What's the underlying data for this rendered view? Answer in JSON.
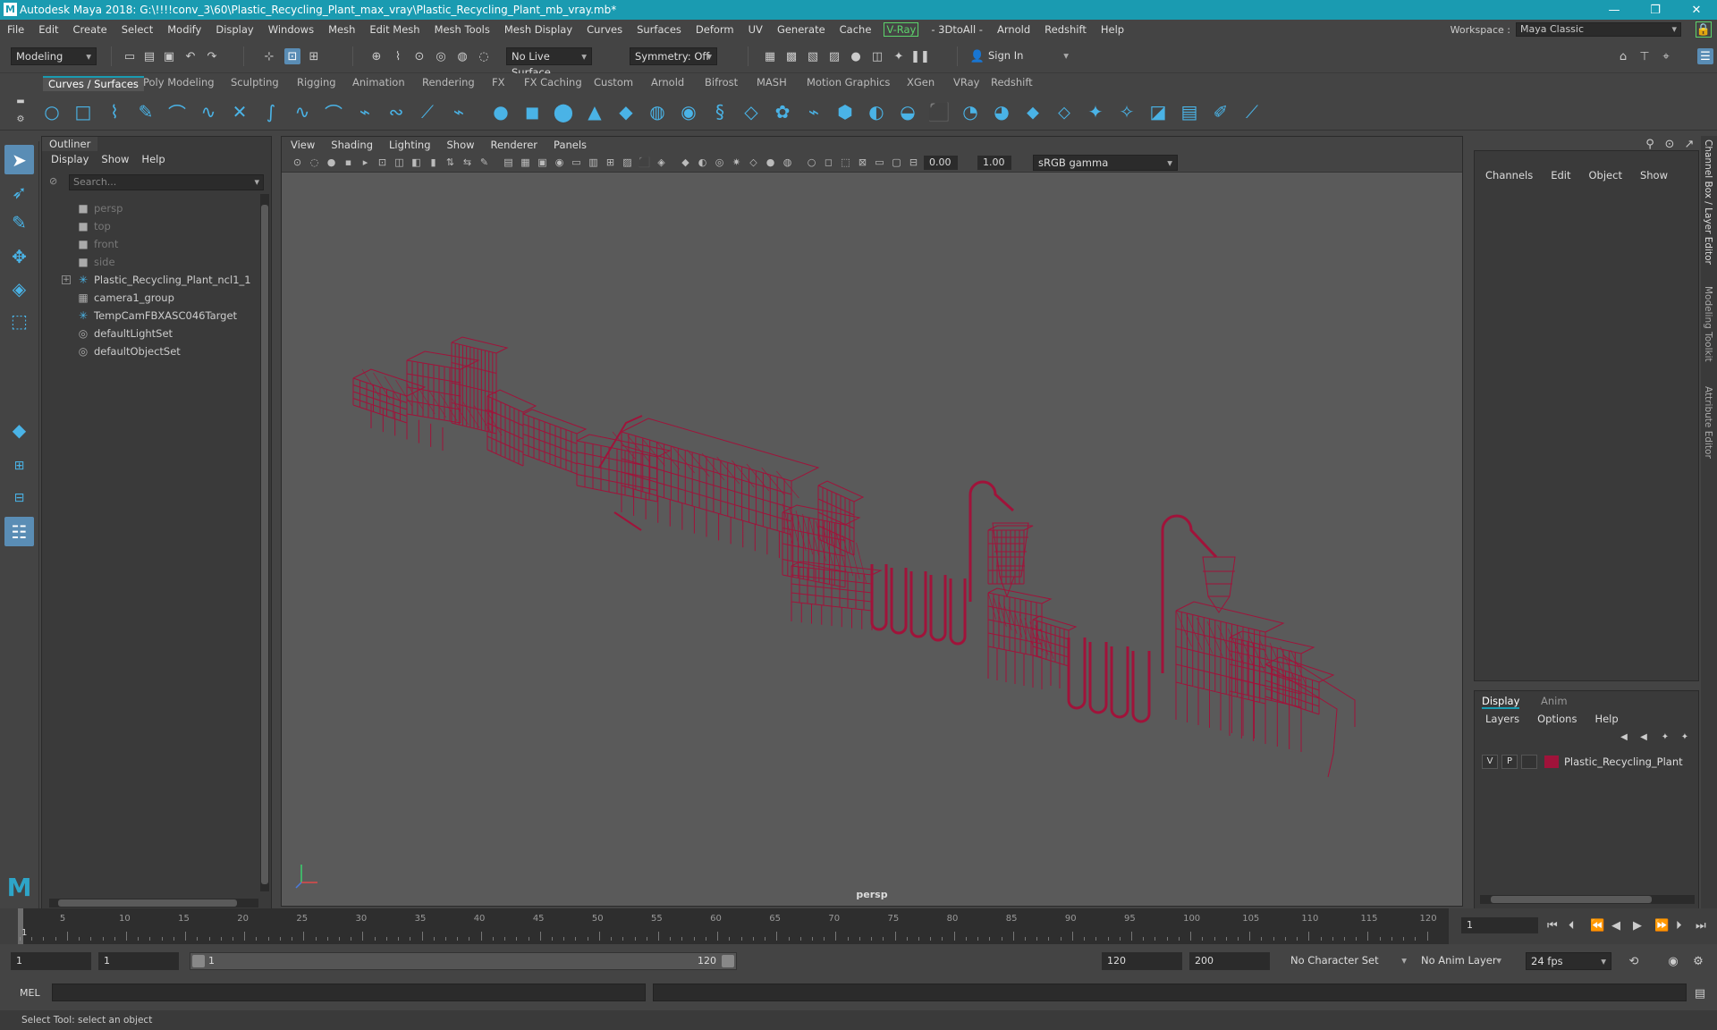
{
  "window": {
    "title": "Autodesk Maya 2018: G:\\!!!!conv_3\\60\\Plastic_Recycling_Plant_max_vray\\Plastic_Recycling_Plant_mb_vray.mb*",
    "logo": "M",
    "min": "—",
    "max": "❐",
    "close": "✕"
  },
  "menu": [
    "File",
    "Edit",
    "Create",
    "Select",
    "Modify",
    "Display",
    "Windows",
    "Mesh",
    "Edit Mesh",
    "Mesh Tools",
    "Mesh Display",
    "Curves",
    "Surfaces",
    "Deform",
    "UV",
    "Generate",
    "Cache"
  ],
  "menu_vray": "V-Ray",
  "menu2": [
    "- 3DtoAll -",
    "Arnold",
    "Redshift",
    "Help"
  ],
  "workspace": {
    "label": "Workspace :",
    "value": "Maya Classic"
  },
  "status": {
    "mode": "Modeling",
    "live_surface": "No Live Surface",
    "symmetry": "Symmetry: Off",
    "sign_in": "Sign In"
  },
  "shelf_tabs": [
    "Curves / Surfaces",
    "Poly Modeling",
    "Sculpting",
    "Rigging",
    "Animation",
    "Rendering",
    "FX",
    "FX Caching",
    "Custom",
    "Arnold",
    "Bifrost",
    "MASH",
    "Motion Graphics",
    "XGen",
    "VRay",
    "Redshift"
  ],
  "outliner": {
    "title": "Outliner",
    "menu": [
      "Display",
      "Show",
      "Help"
    ],
    "search_placeholder": "Search...",
    "items": [
      {
        "label": "persp",
        "icon": "camera-icon",
        "dim": true,
        "exp": false
      },
      {
        "label": "top",
        "icon": "camera-icon",
        "dim": true,
        "exp": false
      },
      {
        "label": "front",
        "icon": "camera-icon",
        "dim": true,
        "exp": false
      },
      {
        "label": "side",
        "icon": "camera-icon",
        "dim": true,
        "exp": false
      },
      {
        "label": "Plastic_Recycling_Plant_ncl1_1",
        "icon": "transform-icon",
        "dim": false,
        "exp": true
      },
      {
        "label": "camera1_group",
        "icon": "group-icon",
        "dim": false,
        "exp": false
      },
      {
        "label": "TempCamFBXASC046Target",
        "icon": "transform-icon",
        "dim": false,
        "exp": false
      },
      {
        "label": "defaultLightSet",
        "icon": "set-icon",
        "dim": false,
        "exp": false
      },
      {
        "label": "defaultObjectSet",
        "icon": "set-icon",
        "dim": false,
        "exp": false
      }
    ]
  },
  "viewport": {
    "menu": [
      "View",
      "Shading",
      "Lighting",
      "Show",
      "Renderer",
      "Panels"
    ],
    "exposure": "0.00",
    "gamma": "1.00",
    "colorspace": "sRGB gamma",
    "camera_label": "persp",
    "wire_color": "#a0133a"
  },
  "channelbox": {
    "menu": [
      "Channels",
      "Edit",
      "Object",
      "Show"
    ]
  },
  "layers": {
    "tabs": [
      "Display",
      "Anim"
    ],
    "menu": [
      "Layers",
      "Options",
      "Help"
    ],
    "row": {
      "v": "V",
      "p": "P",
      "name": "Plastic_Recycling_Plant"
    }
  },
  "side_tabs": [
    "Channel Box / Layer Editor",
    "Modeling Toolkit",
    "Attribute Editor"
  ],
  "timeline": {
    "ticks": [
      5,
      10,
      15,
      20,
      25,
      30,
      35,
      40,
      45,
      50,
      55,
      60,
      65,
      70,
      75,
      80,
      85,
      90,
      95,
      100,
      105,
      110,
      115,
      120
    ],
    "start_tick": "1",
    "current": "1"
  },
  "range": {
    "start": "1",
    "playback_start": "1",
    "slider_start": "1",
    "slider_end": "120",
    "playback_end": "120",
    "end": "200",
    "character_set": "No Character Set",
    "anim_layer": "No Anim Layer",
    "fps": "24 fps"
  },
  "cmd": {
    "label": "MEL"
  },
  "help": "Select Tool: select an object"
}
